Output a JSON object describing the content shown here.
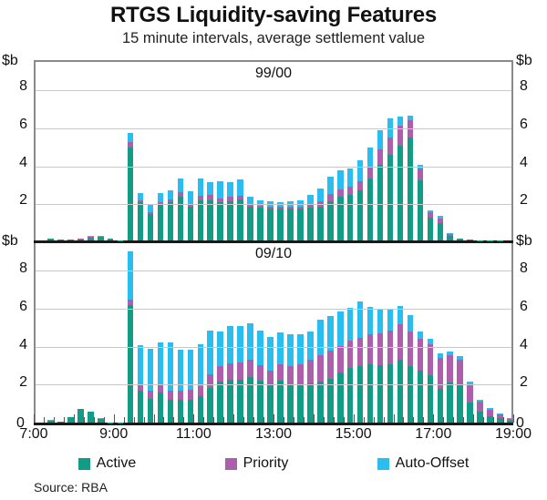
{
  "chart_data": {
    "type": "bar",
    "stacked": true,
    "title": "RTGS Liquidity-saving Features",
    "subtitle": "15 minute intervals, average settlement value",
    "source": "Source: RBA",
    "xlabel": "",
    "ylabel": "$b",
    "unit": "$b",
    "grid": true,
    "legend_position": "bottom",
    "legend": [
      "Active",
      "Priority",
      "Auto-Offset"
    ],
    "colors": {
      "active": "#129B85",
      "priority": "#AE5FAC",
      "auto_offset": "#29BDF0",
      "gridline": "#c9c9c9",
      "axis": "#8a8a8a",
      "text": "#111111"
    },
    "x_tick_labels": [
      "7:00",
      "9:00",
      "11:00",
      "13:00",
      "15:00",
      "17:00",
      "19:00"
    ],
    "x_range": [
      "7:00",
      "19:00"
    ],
    "x_interval_minutes": 15,
    "panels": [
      {
        "label": "99/00",
        "ylim": [
          0,
          9.5
        ],
        "y_ticks": [
          2,
          4,
          6,
          8
        ],
        "y_axis_top_label": "$b",
        "y_axis_bottom_label": "$b",
        "categories": [
          "7:00",
          "7:15",
          "7:30",
          "7:45",
          "8:00",
          "8:15",
          "8:30",
          "8:45",
          "9:00",
          "9:15",
          "9:30",
          "9:45",
          "10:00",
          "10:15",
          "10:30",
          "10:45",
          "11:00",
          "11:15",
          "11:30",
          "11:45",
          "12:00",
          "12:15",
          "12:30",
          "12:45",
          "13:00",
          "13:15",
          "13:30",
          "13:45",
          "14:00",
          "14:15",
          "14:30",
          "14:45",
          "15:00",
          "15:15",
          "15:30",
          "15:45",
          "16:00",
          "16:15",
          "16:30",
          "16:45",
          "17:00",
          "17:15",
          "17:30",
          "17:45",
          "18:00",
          "18:15",
          "18:30",
          "18:45"
        ],
        "series": [
          {
            "name": "Active",
            "values": [
              0.0,
              0.1,
              0.03,
              0.05,
              0.06,
              0.13,
              0.2,
              0.09,
              0.02,
              4.9,
              2.0,
              1.38,
              1.92,
              2.02,
              2.32,
              1.78,
              2.12,
              2.1,
              2.02,
              2.08,
              2.15,
              1.8,
              1.72,
              1.68,
              1.68,
              1.7,
              1.68,
              1.72,
              1.78,
              2.05,
              2.28,
              2.38,
              2.62,
              3.28,
              4.0,
              4.52,
              5.0,
              5.42,
              3.18,
              1.2,
              0.92,
              0.25,
              0.08,
              0.04,
              0.02,
              0.01,
              0.01,
              0.0
            ]
          },
          {
            "name": "Priority",
            "values": [
              0.0,
              0.0,
              0.0,
              0.0,
              0.06,
              0.07,
              0.0,
              0.0,
              0.0,
              0.28,
              0.1,
              0.12,
              0.1,
              0.12,
              0.22,
              0.14,
              0.22,
              0.28,
              0.2,
              0.22,
              0.2,
              0.1,
              0.1,
              0.08,
              0.08,
              0.1,
              0.12,
              0.18,
              0.28,
              0.38,
              0.42,
              0.45,
              0.52,
              0.62,
              0.8,
              0.92,
              1.05,
              0.92,
              0.6,
              0.28,
              0.22,
              0.08,
              0.02,
              0.01,
              0.0,
              0.0,
              0.0,
              0.0
            ]
          },
          {
            "name": "Auto-Offset",
            "values": [
              0.0,
              0.02,
              0.0,
              0.0,
              0.0,
              0.02,
              0.04,
              0.02,
              0.0,
              0.47,
              0.42,
              0.38,
              0.48,
              0.5,
              0.72,
              0.68,
              0.92,
              0.68,
              0.92,
              0.78,
              0.85,
              0.42,
              0.3,
              0.3,
              0.28,
              0.28,
              0.32,
              0.52,
              0.68,
              0.92,
              1.0,
              0.98,
              1.08,
              1.0,
              1.0,
              1.0,
              0.48,
              0.22,
              0.18,
              0.12,
              0.14,
              0.05,
              0.02,
              0.01,
              0.0,
              0.0,
              0.0,
              0.0
            ]
          }
        ]
      },
      {
        "label": "09/10",
        "ylim": [
          0,
          9.5
        ],
        "y_ticks": [
          0,
          2,
          4,
          6,
          8
        ],
        "y_axis_top_label": "$b",
        "y_axis_bottom_label": "0",
        "categories": [
          "7:00",
          "7:15",
          "7:30",
          "7:45",
          "8:00",
          "8:15",
          "8:30",
          "8:45",
          "9:00",
          "9:15",
          "9:30",
          "9:45",
          "10:00",
          "10:15",
          "10:30",
          "10:45",
          "11:00",
          "11:15",
          "11:30",
          "11:45",
          "12:00",
          "12:15",
          "12:30",
          "12:45",
          "13:00",
          "13:15",
          "13:30",
          "13:45",
          "14:00",
          "14:15",
          "14:30",
          "14:45",
          "15:00",
          "15:15",
          "15:30",
          "15:45",
          "16:00",
          "16:15",
          "16:30",
          "16:45",
          "17:00",
          "17:15",
          "17:30",
          "17:45",
          "18:00",
          "18:15",
          "18:30",
          "18:45"
        ],
        "series": [
          {
            "name": "Active",
            "values": [
              0.0,
              0.12,
              0.05,
              0.28,
              0.7,
              0.58,
              0.2,
              0.02,
              0.02,
              6.2,
              1.68,
              1.25,
              1.58,
              1.22,
              1.22,
              1.22,
              1.38,
              1.82,
              2.15,
              2.25,
              2.25,
              2.42,
              2.22,
              1.95,
              2.2,
              2.02,
              1.98,
              2.08,
              2.18,
              2.32,
              2.62,
              2.88,
              2.98,
              3.05,
              3.02,
              3.05,
              3.32,
              2.98,
              2.72,
              2.5,
              1.8,
              2.12,
              2.02,
              1.05,
              0.6,
              0.32,
              0.22,
              0.08
            ]
          },
          {
            "name": "Priority",
            "values": [
              0.0,
              0.0,
              0.0,
              0.0,
              0.0,
              0.0,
              0.0,
              0.0,
              0.0,
              0.3,
              0.32,
              0.42,
              0.38,
              0.48,
              0.48,
              0.5,
              0.55,
              0.72,
              0.85,
              0.88,
              0.9,
              0.9,
              0.82,
              0.78,
              0.85,
              0.95,
              1.1,
              1.22,
              1.38,
              1.48,
              1.42,
              1.45,
              1.5,
              1.62,
              1.7,
              1.78,
              1.88,
              1.82,
              1.7,
              1.62,
              1.62,
              1.42,
              1.28,
              0.98,
              0.52,
              0.35,
              0.22,
              0.12
            ]
          },
          {
            "name": "Auto-Offset",
            "values": [
              0.0,
              0.02,
              0.0,
              0.02,
              0.02,
              0.02,
              0.02,
              0.0,
              0.0,
              2.5,
              2.1,
              2.22,
              2.28,
              2.52,
              2.12,
              2.1,
              2.2,
              2.32,
              1.82,
              1.98,
              1.92,
              1.92,
              1.8,
              1.78,
              1.68,
              1.7,
              1.58,
              1.48,
              1.85,
              1.82,
              1.82,
              1.7,
              1.88,
              1.42,
              1.28,
              1.12,
              0.92,
              0.88,
              0.4,
              0.32,
              0.22,
              0.18,
              0.22,
              0.12,
              0.1,
              0.08,
              0.05,
              0.04
            ]
          }
        ]
      }
    ]
  }
}
